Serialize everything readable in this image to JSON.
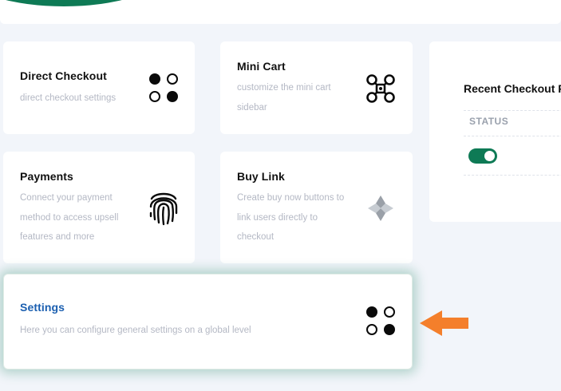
{
  "colors": {
    "brand_green": "#0e7a55",
    "settings_title": "#1b5fb0",
    "arrow": "#f47f2b",
    "muted_text": "#b4b8c4"
  },
  "cards": {
    "direct_checkout": {
      "title": "Direct Checkout",
      "desc": "direct checkout settings",
      "icon": "four-dots-icon"
    },
    "mini_cart": {
      "title": "Mini Cart",
      "desc": "customize the mini cart sidebar",
      "icon": "drone-icon"
    },
    "payments": {
      "title": "Payments",
      "desc": "Connect your payment method to access upsell features and more",
      "icon": "fingerprint-icon"
    },
    "buy_link": {
      "title": "Buy Link",
      "desc": "Create buy now buttons to link users directly to checkout",
      "icon": "star-shape-icon"
    },
    "settings": {
      "title": "Settings",
      "desc": "Here you can configure general settings on a global level",
      "icon": "four-dots-icon"
    }
  },
  "recent_checkout": {
    "heading": "Recent Checkout F",
    "column_status": "STATUS",
    "status_toggle_on": true
  },
  "pointer": {
    "icon": "arrow-left-icon"
  }
}
